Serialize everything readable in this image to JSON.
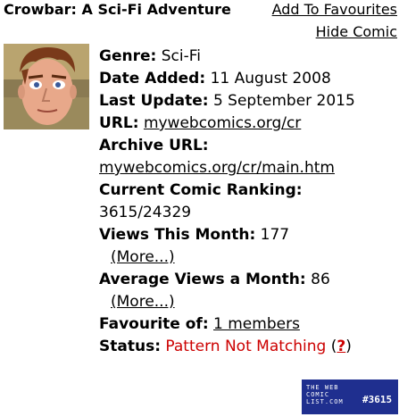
{
  "header": {
    "title": "Crowbar: A Sci-Fi Adventure",
    "add_favourites": "Add To Favourites",
    "hide_comic": "Hide Comic"
  },
  "details": {
    "genre_label": "Genre:",
    "genre_value": "Sci-Fi",
    "date_added_label": "Date Added:",
    "date_added_value": "11 August 2008",
    "last_update_label": "Last Update:",
    "last_update_value": "5 September 2015",
    "url_label": "URL:",
    "url_value": "mywebcomics.org/cr",
    "archive_label": "Archive URL:",
    "archive_value": "mywebcomics.org/cr/main.htm",
    "ranking_label": "Current Comic Ranking:",
    "ranking_value": "3615/24329",
    "views_month_label": "Views This Month:",
    "views_month_value": "177",
    "more_label": "(More...)",
    "avg_views_label": "Average Views a Month:",
    "avg_views_value": "86",
    "favourite_label": "Favourite of:",
    "favourite_value": "1 members",
    "status_label": "Status:",
    "status_value": "Pattern Not Matching",
    "status_help": "?"
  },
  "badge": {
    "line1": "THE WEB",
    "line2": "COMIC",
    "line3": "LIST.COM",
    "rank": "#3615"
  },
  "colors": {
    "status": "#cc0000",
    "badge_bg": "#1f2f8f"
  },
  "icons": {
    "avatar": "cartoon-face-avatar",
    "help": "question-mark-icon"
  }
}
